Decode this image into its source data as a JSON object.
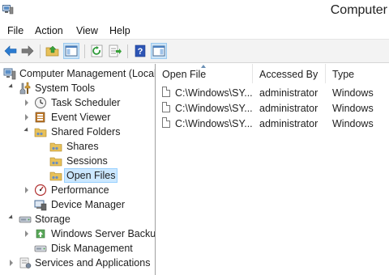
{
  "window": {
    "title": "Computer"
  },
  "menu": {
    "items": [
      "File",
      "Action",
      "View",
      "Help"
    ]
  },
  "toolbar": {
    "buttons": [
      {
        "icon": "back-arrow-icon"
      },
      {
        "icon": "forward-arrow-icon"
      },
      {
        "icon": "up-folder-icon"
      },
      {
        "icon": "show-hide-console-tree-icon"
      },
      {
        "icon": "refresh-icon"
      },
      {
        "icon": "export-list-icon"
      },
      {
        "icon": "help-icon"
      },
      {
        "icon": "show-action-pane-icon"
      }
    ]
  },
  "tree": {
    "items": [
      {
        "label": "Computer Management (Local",
        "icon": "computer-management-icon",
        "expanded": true
      },
      {
        "label": "System Tools",
        "icon": "system-tools-icon",
        "expanded": true
      },
      {
        "label": "Task Scheduler",
        "icon": "clock-icon",
        "expanded": false
      },
      {
        "label": "Event Viewer",
        "icon": "event-viewer-icon",
        "expanded": false
      },
      {
        "label": "Shared Folders",
        "icon": "shared-folder-icon",
        "expanded": true
      },
      {
        "label": "Shares",
        "icon": "shared-folder-icon"
      },
      {
        "label": "Sessions",
        "icon": "shared-folder-icon"
      },
      {
        "label": "Open Files",
        "icon": "shared-folder-icon",
        "selected": true
      },
      {
        "label": "Performance",
        "icon": "performance-icon",
        "expanded": false
      },
      {
        "label": "Device Manager",
        "icon": "device-manager-icon"
      },
      {
        "label": "Storage",
        "icon": "storage-icon",
        "expanded": true
      },
      {
        "label": "Windows Server Backup",
        "icon": "backup-icon",
        "expanded": false
      },
      {
        "label": "Disk Management",
        "icon": "disk-icon"
      },
      {
        "label": "Services and Applications",
        "icon": "services-icon",
        "expanded": false
      }
    ]
  },
  "list": {
    "columns": [
      "Open File",
      "Accessed By",
      "Type"
    ],
    "sort_column": "Open File",
    "rows": [
      {
        "open_file": "C:\\Windows\\SY...",
        "accessed_by": "administrator",
        "type": "Windows"
      },
      {
        "open_file": "C:\\Windows\\SY...",
        "accessed_by": "administrator",
        "type": "Windows"
      },
      {
        "open_file": "C:\\Windows\\SY...",
        "accessed_by": "administrator",
        "type": "Windows"
      }
    ]
  },
  "colors": {
    "selection": "#cce8ff",
    "toolbar_bg": "#f3f3f3",
    "accent": "#0078d7"
  }
}
